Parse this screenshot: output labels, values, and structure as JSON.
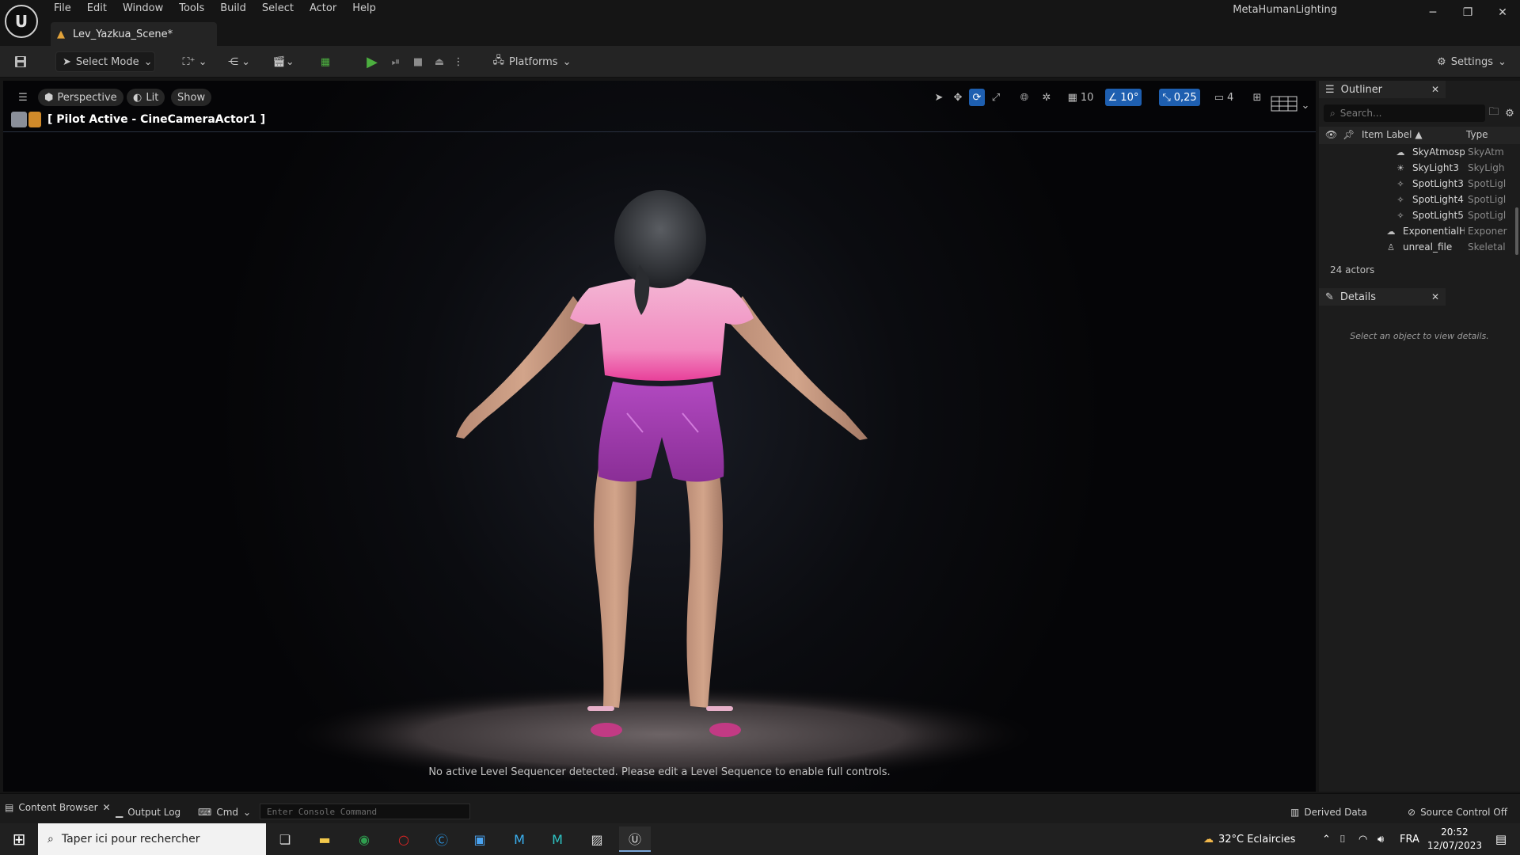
{
  "menu": [
    "File",
    "Edit",
    "Window",
    "Tools",
    "Build",
    "Select",
    "Actor",
    "Help"
  ],
  "app_logo": "U",
  "document_tab": "Lev_Yazkua_Scene*",
  "project_name": "MetaHumanLighting",
  "window_controls": {
    "minimize": "─",
    "restore": "❐",
    "close": "✕"
  },
  "toolbar": {
    "select_mode": "Select Mode",
    "platforms": "Platforms",
    "settings": "Settings"
  },
  "viewport": {
    "perspective": "Perspective",
    "lit": "Lit",
    "show": "Show",
    "grid_snap": "10",
    "rotation_snap": "10°",
    "scale_snap": "0,25",
    "camera_speed": "4",
    "pilot": "[ Pilot Active - CineCameraActor1 ]",
    "sequencer_message": "No active Level Sequencer detected. Please edit a Level Sequence to enable full controls."
  },
  "outliner": {
    "title": "Outliner",
    "search_placeholder": "Search...",
    "col_label": "Item Label ▲",
    "col_type": "Type",
    "rows": [
      {
        "name": "SkyAtmosp",
        "type": "SkyAtm",
        "icon": "☁"
      },
      {
        "name": "SkyLight3",
        "type": "SkyLigh",
        "icon": "☀"
      },
      {
        "name": "SpotLight3",
        "type": "SpotLigl",
        "icon": "✧"
      },
      {
        "name": "SpotLight4",
        "type": "SpotLigl",
        "icon": "✧"
      },
      {
        "name": "SpotLight5",
        "type": "SpotLigl",
        "icon": "✧"
      },
      {
        "name": "ExponentialH",
        "type": "Exponer",
        "icon": "☁"
      },
      {
        "name": "unreal_file",
        "type": "Skeletal",
        "icon": "♙"
      }
    ],
    "actor_count": "24 actors"
  },
  "details": {
    "title": "Details",
    "empty_message": "Select an object to view details."
  },
  "bottom": {
    "content_browser": "Content Browser",
    "output_log": "Output Log",
    "cmd": "Cmd",
    "console_placeholder": "Enter Console Command",
    "derived_data": "Derived Data",
    "source_control": "Source Control Off"
  },
  "taskbar": {
    "search_placeholder": "Taper ici pour rechercher",
    "weather": "32°C  Eclaircies",
    "language": "FRA",
    "time": "20:52",
    "date": "12/07/2023"
  },
  "colors": {
    "accent_blue": "#1e5fb0",
    "play_green": "#4caf3f",
    "shirt_pink": "#f090c4",
    "shorts_purple": "#9a3aa8"
  }
}
